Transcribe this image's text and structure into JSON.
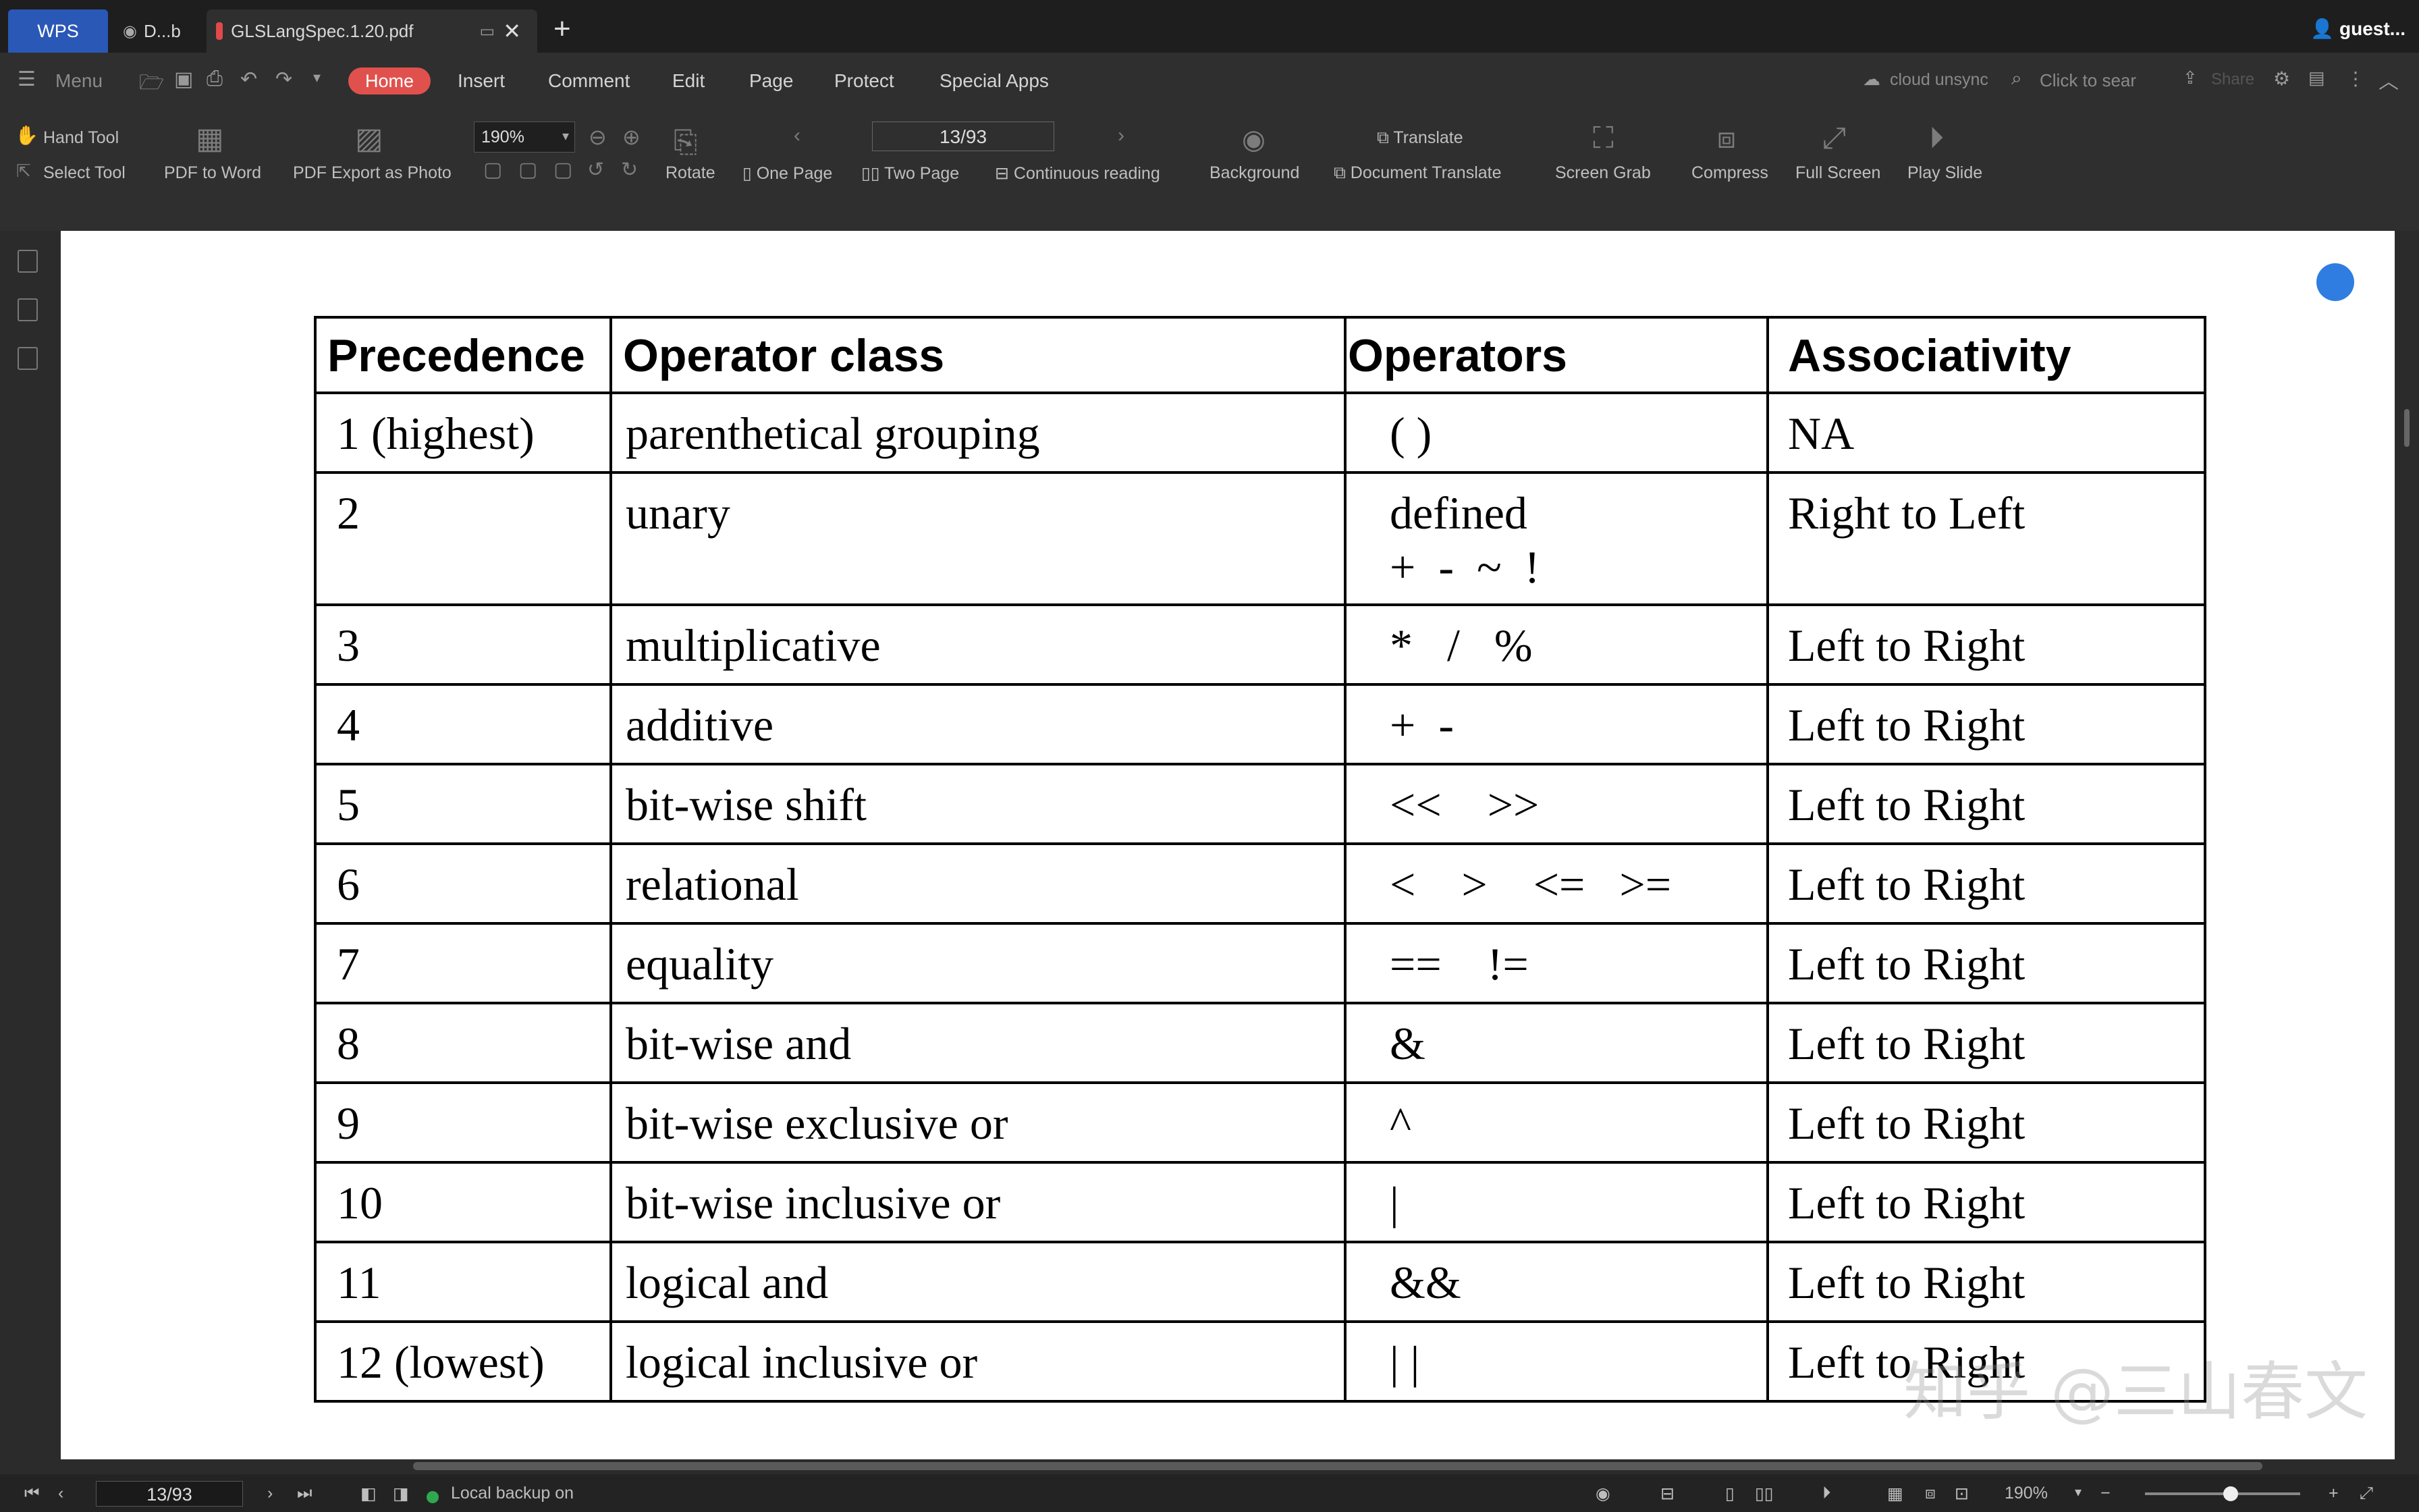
{
  "tabs": {
    "wps": "WPS",
    "doc": "D...b",
    "pdf": "GLSLangSpec.1.20.pdf",
    "user": "guest..."
  },
  "menubar": {
    "menu": "Menu",
    "items": [
      "Home",
      "Insert",
      "Comment",
      "Edit",
      "Page",
      "Protect",
      "Special Apps"
    ],
    "cloud": "cloud unsync",
    "search": "Click to sear",
    "share": "Share"
  },
  "ribbon": {
    "hand_tool": "Hand Tool",
    "select_tool": "Select Tool",
    "pdf_to_word": "PDF to Word",
    "pdf_export_photo": "PDF Export as Photo",
    "zoom": "190%",
    "page": "13/93",
    "rotate": "Rotate",
    "one_page": "One Page",
    "two_page": "Two Page",
    "continuous": "Continuous reading",
    "background": "Background",
    "translate": "Translate",
    "doc_translate": "Document Translate",
    "screen_grab": "Screen Grab",
    "compress": "Compress",
    "full_screen": "Full Screen",
    "play_slide": "Play Slide"
  },
  "table": {
    "headers": [
      "Precedence",
      "Operator class",
      "Operators",
      "Associativity"
    ],
    "rows": [
      [
        "1  (highest)",
        "parenthetical grouping",
        "( )",
        "NA"
      ],
      [
        "2",
        "unary",
        "defined\n+  -  ~  !",
        "Right to Left"
      ],
      [
        "3",
        "multiplicative",
        "*   /   %",
        "Left to Right"
      ],
      [
        "4",
        "additive",
        "+  -",
        "Left to Right"
      ],
      [
        "5",
        "bit-wise shift",
        "<<    >>",
        "Left to Right"
      ],
      [
        "6",
        "relational",
        "<    >    <=   >=",
        "Left to Right"
      ],
      [
        "7",
        "equality",
        "==    !=",
        "Left to Right"
      ],
      [
        "8",
        "bit-wise and",
        "&",
        "Left to Right"
      ],
      [
        "9",
        "bit-wise exclusive or",
        "^",
        "Left to Right"
      ],
      [
        "10",
        "bit-wise inclusive or",
        "|",
        "Left to Right"
      ],
      [
        "11",
        "logical and",
        "&&",
        "Left to Right"
      ],
      [
        "12 (lowest)",
        "logical inclusive or",
        "| |",
        "Left to Right"
      ]
    ]
  },
  "watermark": "知乎 @三山春文",
  "status": {
    "page": "13/93",
    "backup": "Local backup on",
    "zoom": "190%"
  }
}
